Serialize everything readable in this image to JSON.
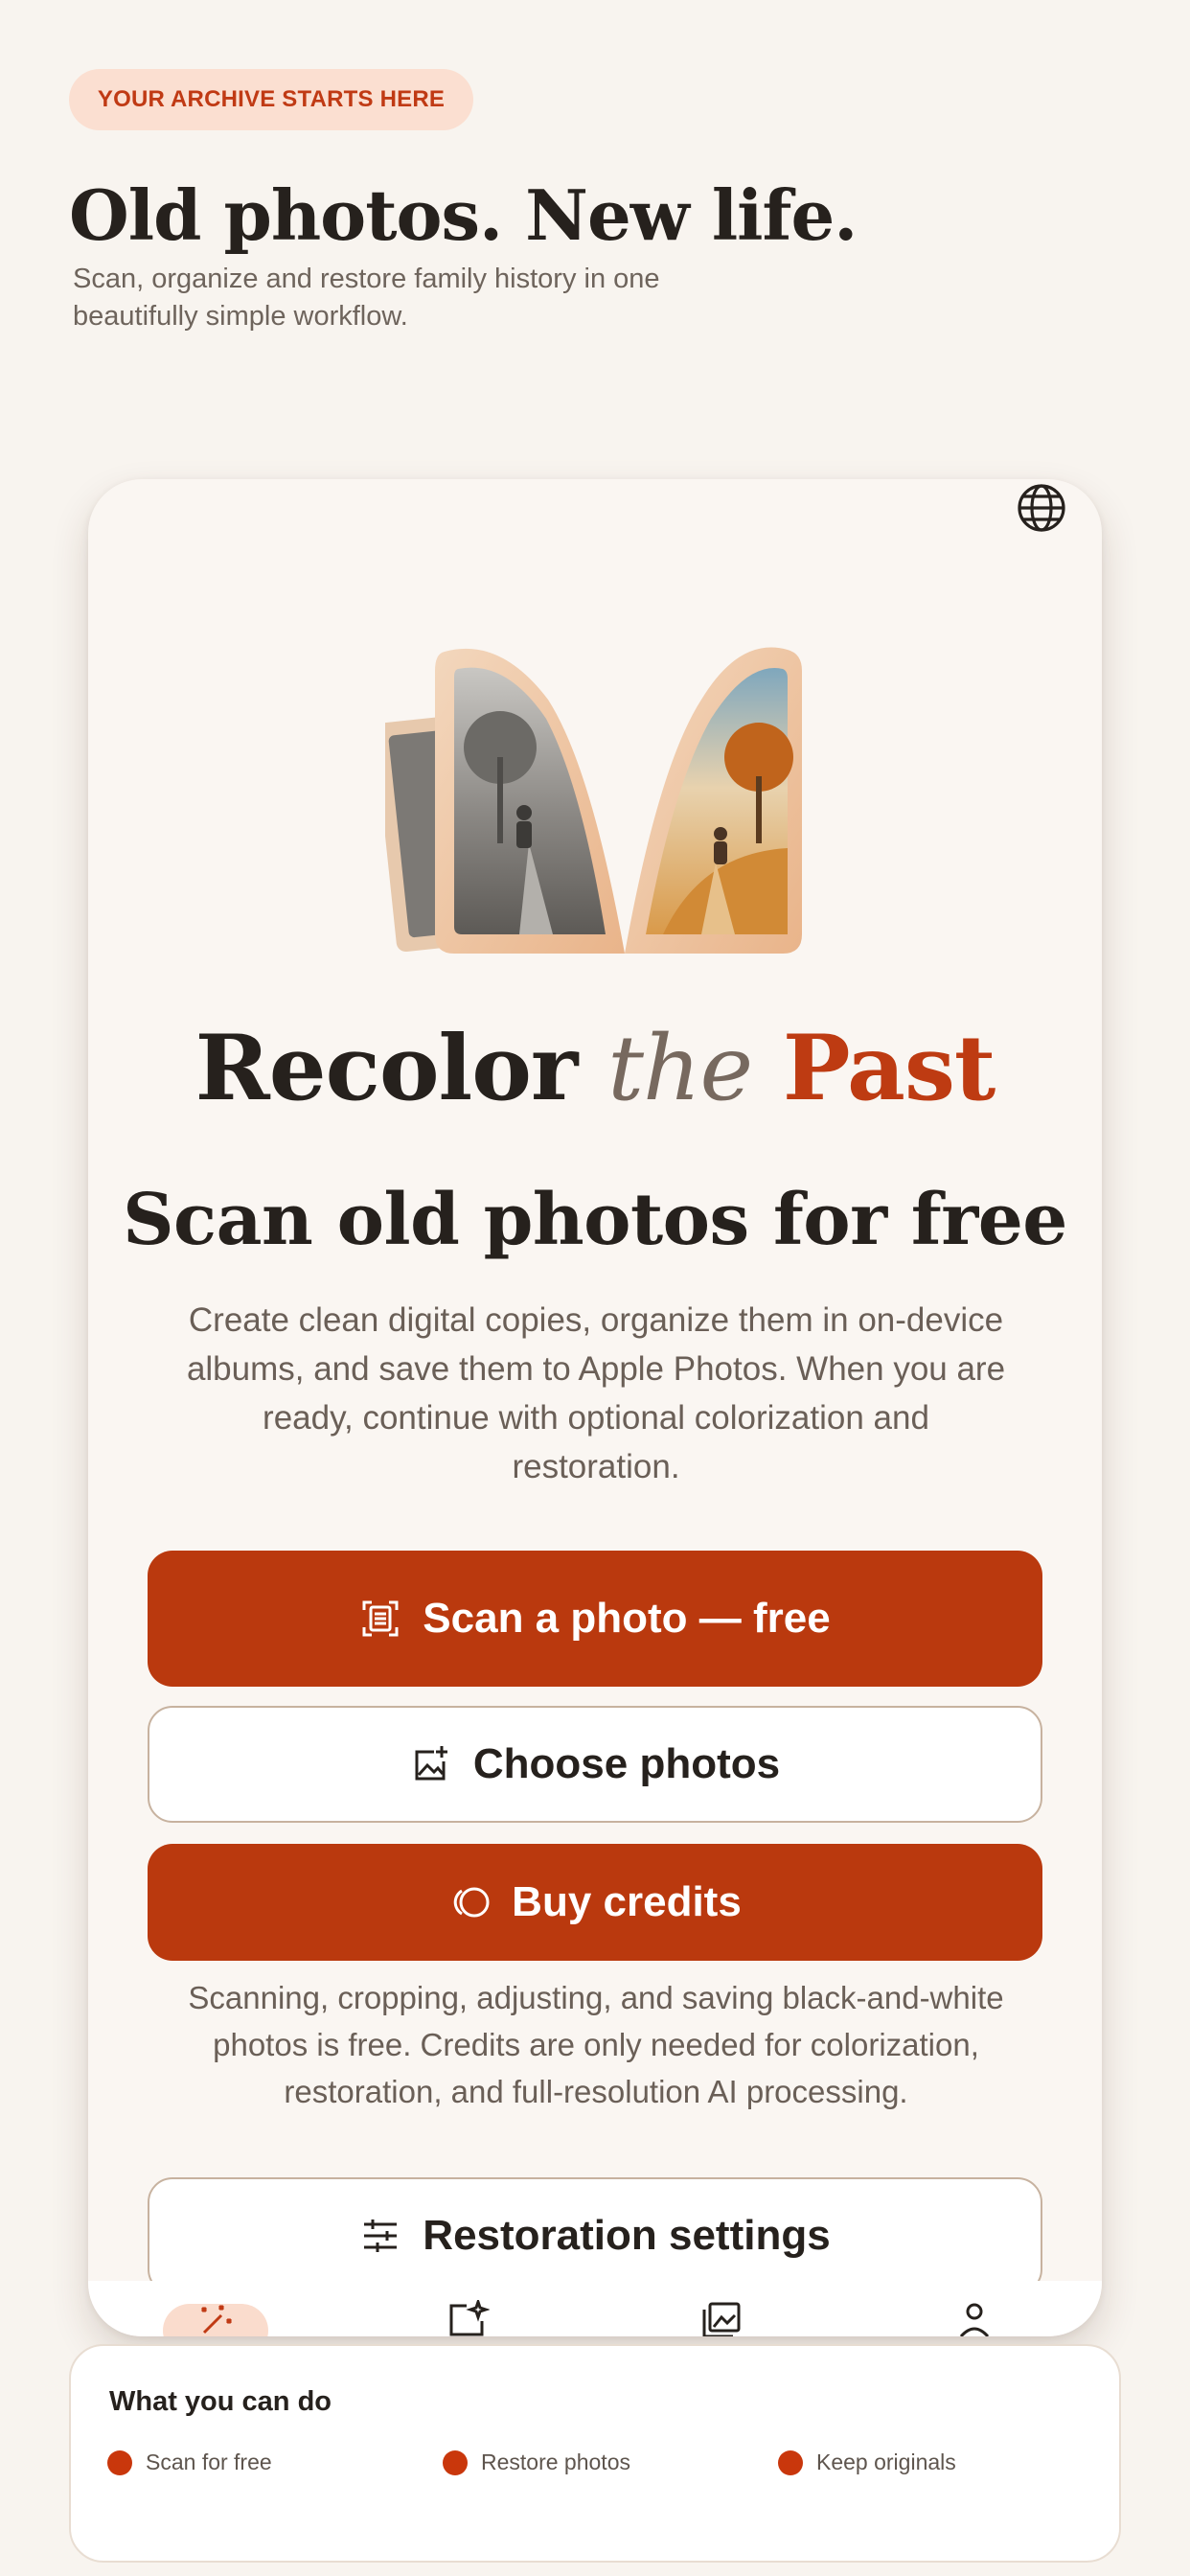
{
  "header": {
    "badge": "YOUR ARCHIVE STARTS HERE",
    "headline": "Old photos. New life.",
    "subline": "Scan, organize and restore family history in one beautifully simple workflow."
  },
  "app": {
    "language_icon": "globe-icon",
    "title": {
      "part1": "Recolor",
      "part2": "the",
      "part3": "Past"
    },
    "subtitle": "Scan old photos for free",
    "intro": "Create clean digital copies, organize them in on-device albums, and save them to Apple Photos. When you are ready, continue with optional colorization and restoration.",
    "buttons": {
      "scan": {
        "label": "Scan a photo — free",
        "icon": "document-scan-icon"
      },
      "choose": {
        "label": "Choose photos",
        "icon": "add-photo-icon"
      },
      "credits": {
        "label": "Buy credits",
        "icon": "coins-icon"
      },
      "settings": {
        "label": "Restoration settings",
        "icon": "sliders-icon"
      }
    },
    "credits_note": "Scanning, cropping, adjusting, and saving black-and-white photos is free. Credits are only needed for colorization, restoration, and full-resolution AI processing.",
    "tabs": [
      {
        "icon": "magic-wand-icon",
        "active": true
      },
      {
        "icon": "sparkle-photo-icon",
        "active": false
      },
      {
        "icon": "photo-library-icon",
        "active": false
      },
      {
        "icon": "profile-icon",
        "active": false
      }
    ]
  },
  "features": {
    "title": "What you can do",
    "items": [
      "Scan for free",
      "Restore photos",
      "Keep originals"
    ]
  },
  "colors": {
    "accent": "#ba390e",
    "background": "#f8f4ef",
    "badge_bg": "#fbdfd1"
  }
}
